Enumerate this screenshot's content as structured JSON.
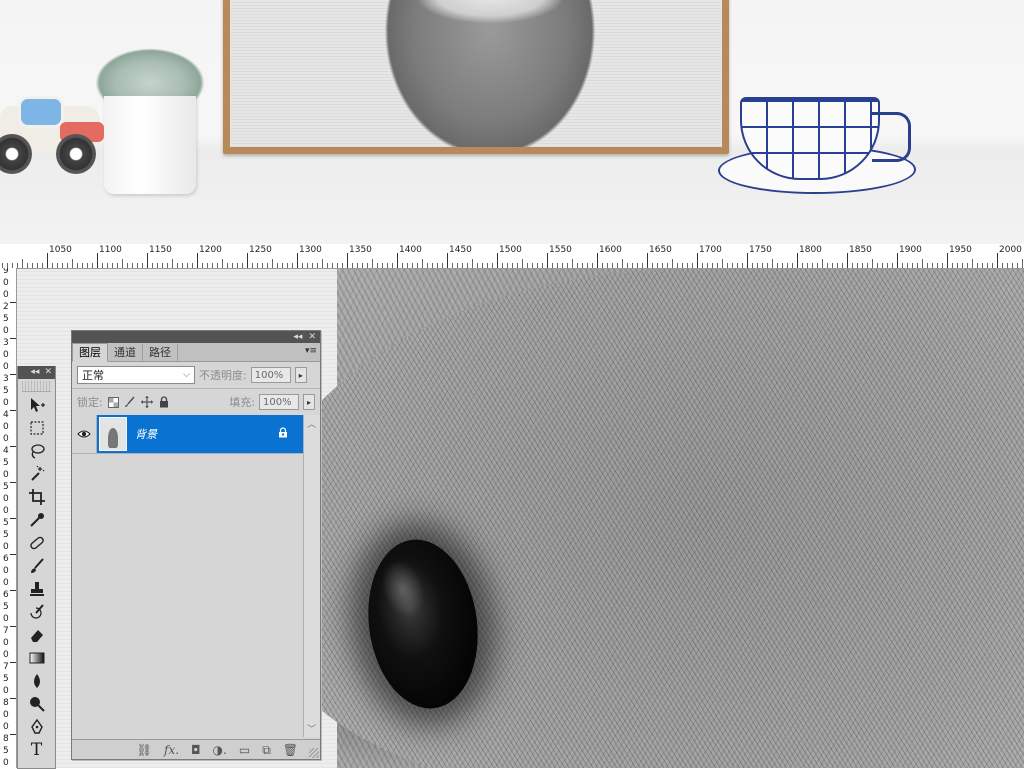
{
  "ruler": {
    "horizontal_labels": [
      "1050",
      "1100",
      "1150",
      "1200",
      "1250",
      "1300",
      "1350",
      "1400",
      "1450",
      "1500",
      "1550",
      "1600",
      "1650",
      "1700",
      "1750",
      "1800",
      "1850",
      "1900",
      "1950",
      "2000"
    ],
    "vertical_labels": [
      "9",
      "0",
      "0",
      "2",
      "5",
      "0",
      "3",
      "0",
      "0",
      "3",
      "5",
      "0",
      "4",
      "0",
      "0",
      "4",
      "5",
      "0",
      "5",
      "0",
      "0",
      "5",
      "5",
      "0",
      "6",
      "0",
      "0",
      "6",
      "5",
      "0",
      "7",
      "0",
      "0",
      "7",
      "5",
      "0",
      "8",
      "0",
      "0",
      "8",
      "5",
      "0"
    ]
  },
  "layers_panel": {
    "tabs": [
      "图层",
      "通道",
      "路径"
    ],
    "active_tab": 0,
    "blend_mode": "正常",
    "opacity_label": "不透明度:",
    "opacity_value": "100%",
    "lock_label": "锁定:",
    "fill_label": "填充:",
    "fill_value": "100%",
    "layers": [
      {
        "name": "背景",
        "visible": true,
        "locked": true,
        "selected": true
      }
    ],
    "footer_buttons": [
      "link-icon",
      "fx-icon",
      "mask-icon",
      "adjustment-icon",
      "group-icon",
      "new-layer-icon",
      "trash-icon"
    ]
  },
  "tools_panel": {
    "tools": [
      "move-tool-icon",
      "marquee-tool-icon",
      "lasso-tool-icon",
      "magic-wand-icon",
      "crop-tool-icon",
      "eyedropper-icon",
      "healing-brush-icon",
      "brush-tool-icon",
      "stamp-tool-icon",
      "history-brush-icon",
      "eraser-tool-icon",
      "gradient-tool-icon",
      "blur-tool-icon",
      "dodge-tool-icon",
      "pen-tool-icon",
      "type-tool-icon"
    ]
  },
  "colors": {
    "selection_blue": "#0a72d0",
    "panel_gray": "#d6d6d6",
    "panel_header": "#535353",
    "frame_wood": "#b88a59",
    "cup_blue": "#2b3f8f"
  }
}
